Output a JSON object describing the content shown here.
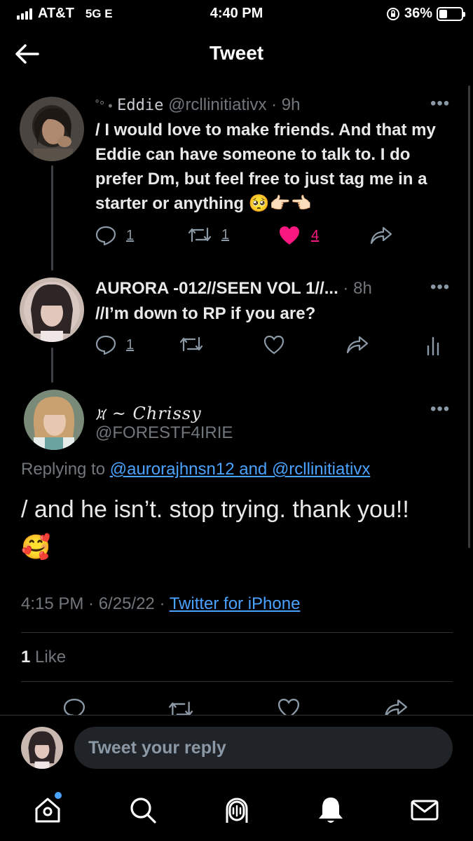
{
  "status_bar": {
    "carrier": "AT&T",
    "network": "5G E",
    "time": "4:40 PM",
    "battery": "36%",
    "battery_level": 0.36
  },
  "header": {
    "title": "Tweet"
  },
  "tweets": [
    {
      "display_name": "̥ͦͦ • Eddie",
      "prefix": "˚° •",
      "name_text": "Eddie",
      "handle": "@rcllinitiativx",
      "time": "9h",
      "text": "/ I would love to make friends.  And that my Eddie can have someone to talk to. I do prefer Dm, but feel free to just tag me in a starter or anything 🥺👉🏻👈🏻",
      "reply_count": "1",
      "retweet_count": "1",
      "like_count": "4"
    },
    {
      "display_name": "AURORA -012//SEEN VOL 1//...",
      "time": "8h",
      "text": "//I’m down to RP if you are?",
      "reply_count": "1"
    }
  ],
  "main_tweet": {
    "display_name": "᰿ ~ Chrissy",
    "handle": "@FORESTF4IRIE",
    "replying_label": "Replying to",
    "replying_to": "@aurorajhnsn12 and @rcllinitiativx",
    "text": "/ and he isn’t. stop trying. thank you!! 🥰",
    "timestamp": "4:15 PM · 6/25/22 ·",
    "source": "Twitter for iPhone",
    "likes_count": "1",
    "likes_label": "Like"
  },
  "reply_bar": {
    "placeholder": "Tweet your reply"
  },
  "colors": {
    "accent": "#4aa3ff",
    "like": "#f91880"
  }
}
